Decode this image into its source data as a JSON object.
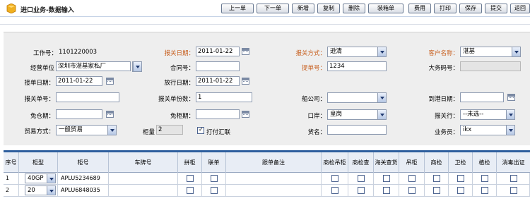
{
  "header": {
    "title": "进口业务-数据输入"
  },
  "toolbar": [
    "上一单",
    "下一单",
    "新增",
    "复制",
    "删除",
    "装箱单",
    "费用",
    "打印",
    "保存",
    "提交",
    "返回"
  ],
  "form": {
    "job_no_label": "工作号：",
    "job_no_value": "1101220003",
    "declare_date_label": "报关日期：",
    "declare_date_value": "2011-01-22",
    "declare_method_label": "报关方式：",
    "declare_method_value": "逊清",
    "customer_label": "客户名称：",
    "customer_value": "湛基",
    "operator_unit_label": "经营单位",
    "operator_unit_value": "深圳市湛基家私厂",
    "contract_label": "合同号：",
    "contract_value": "",
    "bill_label": "提单号：",
    "bill_value": "1234",
    "multi_code_label": "大务码号：",
    "multi_code_value": "",
    "receive_date_label": "接单日期：",
    "receive_date_value": "2011-01-22",
    "release_date_label": "放行日期：",
    "release_date_value": "2011-01-22",
    "declare_no_label": "报关单号：",
    "declare_no_value": "",
    "declare_copies_label": "报关单份数：",
    "declare_copies_value": "1",
    "shipping_co_label": "船公司：",
    "shipping_co_value": "",
    "arrival_date_label": "到港日期：",
    "arrival_date_value": "",
    "free_period_label": "免仓期：",
    "free_period_value": "",
    "free_box_label": "免柜期：",
    "free_box_value": "",
    "port_label": "口岸：",
    "port_value": "皇岗",
    "declare_bank_label": "报关行：",
    "declare_bank_value": "--未选--",
    "trade_mode_label": "贸易方式：",
    "trade_mode_value": "一般贸易",
    "container_qty_label": "柜量",
    "container_qty_value": "2",
    "print_invoice_label": "打付汇联",
    "goods_name_label": "货名：",
    "goods_name_value": "",
    "salesman_label": "业务员：",
    "salesman_value": "ikx"
  },
  "grid": {
    "columns": [
      "序号",
      "柜型",
      "柜号",
      "车牌号",
      "拼柜",
      "联单",
      "跟单备注",
      "商检吊柜",
      "商检查",
      "海关查货",
      "吊柜",
      "商检",
      "卫检",
      "植检",
      "消毒出证"
    ],
    "rows": [
      {
        "no": "1",
        "type": "40GP",
        "container": "APLU5234689",
        "plate": "",
        "note": ""
      },
      {
        "no": "2",
        "type": "20",
        "container": "APLU6848035",
        "plate": "",
        "note": ""
      }
    ]
  }
}
